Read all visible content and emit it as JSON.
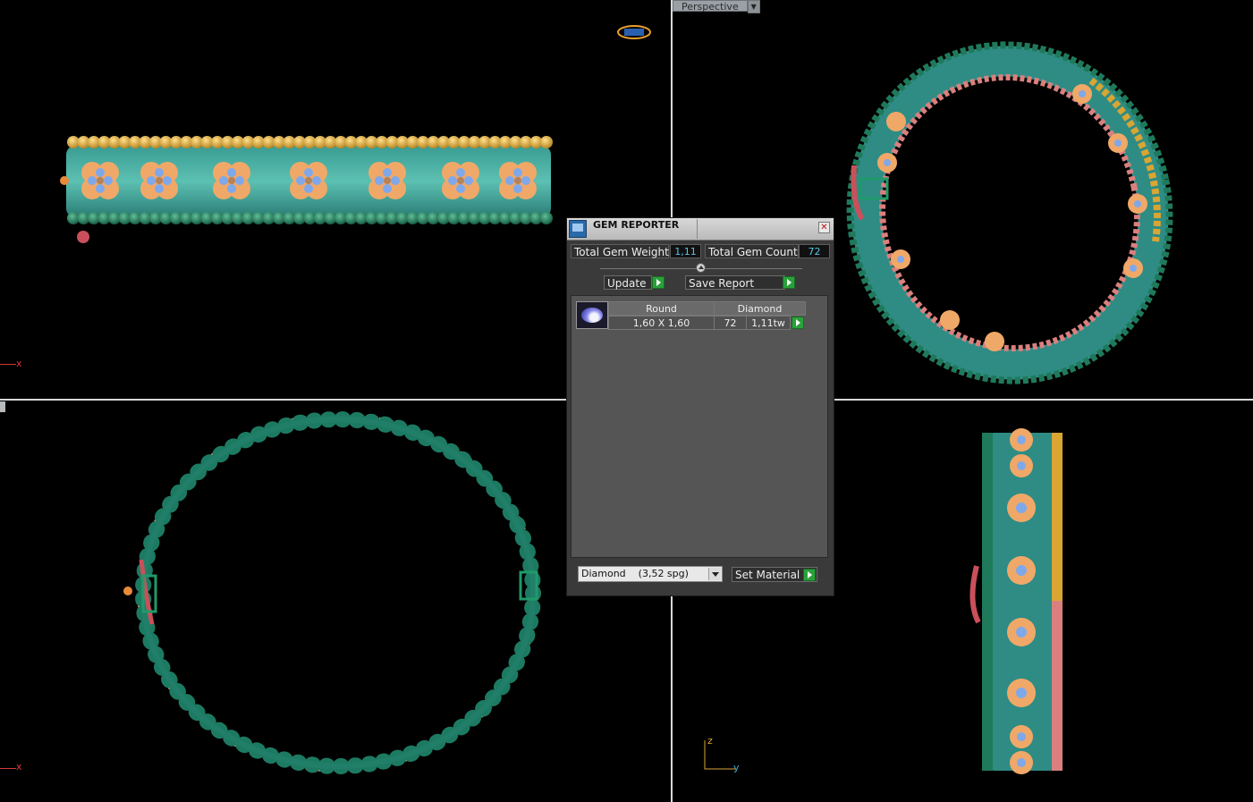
{
  "viewports": {
    "top_left": {
      "name": "front view",
      "axis_label": "x"
    },
    "top_right": {
      "name": "perspective view",
      "label": "Perspective"
    },
    "bottom_left": {
      "name": "top view",
      "axis_label": "x"
    },
    "bottom_right": {
      "name": "side view",
      "axis_labels": [
        "z",
        "y"
      ]
    }
  },
  "gem_reporter": {
    "title": "GEM REPORTER",
    "close_glyph": "✕",
    "total_gem_weight_label": "Total Gem Weight",
    "total_gem_weight_value": "1,11",
    "total_gem_count_label": "Total Gem Count",
    "total_gem_count_value": "72",
    "update_label": "Update",
    "save_report_label": "Save Report",
    "table": {
      "headers": [
        "Round",
        "Diamond"
      ],
      "rows": [
        {
          "size": "1,60 X 1,60",
          "count": "72",
          "weight": "1,11tw"
        }
      ]
    },
    "material_select_value": "Diamond    (3,52 spg)",
    "set_material_label": "Set Material"
  },
  "colors": {
    "teal_band": "#2e8c84",
    "gold_beads": "#d9a533",
    "green_beads": "#1f7a5b",
    "flower_peach": "#f0a868",
    "stone_blue": "#7fa8ea",
    "rose": "#d9807e",
    "panel_bg": "#3a3a3a",
    "value_cyan": "#58c7e8",
    "go_green": "#29a13a"
  }
}
